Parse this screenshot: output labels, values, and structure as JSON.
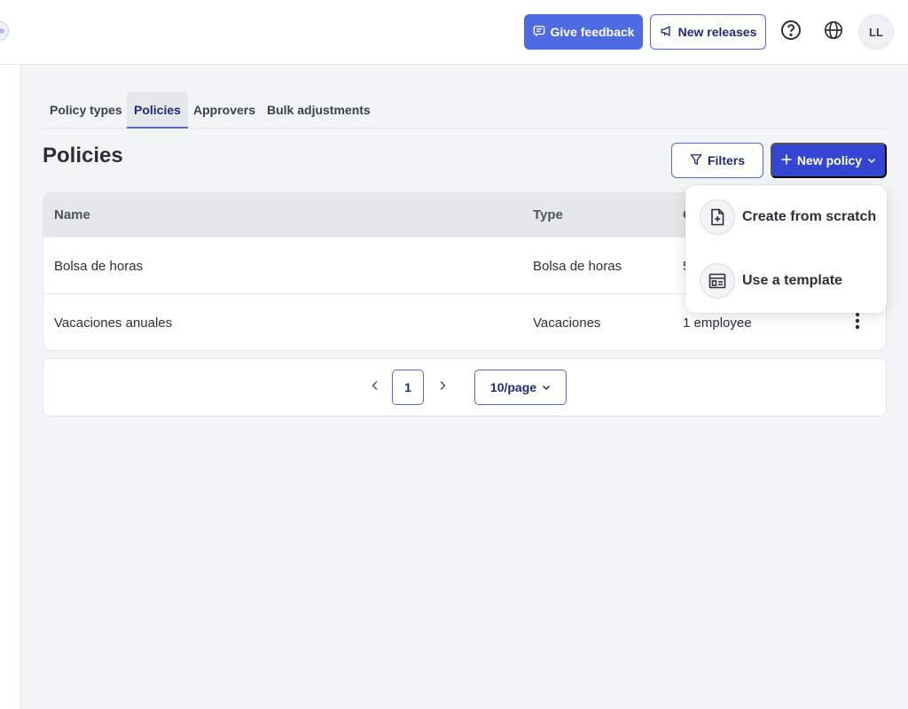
{
  "header": {
    "feedback_label": "Give feedback",
    "releases_label": "New releases",
    "avatar_initials": "LL"
  },
  "tabs": [
    {
      "label": "Policy types",
      "active": false
    },
    {
      "label": "Policies",
      "active": true
    },
    {
      "label": "Approvers",
      "active": false
    },
    {
      "label": "Bulk adjustments",
      "active": false
    }
  ],
  "page": {
    "title": "Policies",
    "filters_label": "Filters",
    "new_policy_label": "New policy"
  },
  "table": {
    "columns": [
      "Name",
      "Type",
      "C"
    ],
    "rows": [
      {
        "name": "Bolsa de horas",
        "type": "Bolsa de horas",
        "assigned": "5"
      },
      {
        "name": "Vacaciones anuales",
        "type": "Vacaciones",
        "assigned": "1 employee"
      }
    ]
  },
  "pagination": {
    "current_page": "1",
    "page_size": "10/page"
  },
  "new_policy_menu": {
    "items": [
      {
        "label": "Create from scratch",
        "icon": "file-plus-icon"
      },
      {
        "label": "Use a template",
        "icon": "template-icon"
      }
    ]
  },
  "colors": {
    "primary": "#4f6be4",
    "primary_dark": "#3445d1",
    "text_dark_blue": "#1e2a78",
    "background": "#f3f4f6"
  }
}
